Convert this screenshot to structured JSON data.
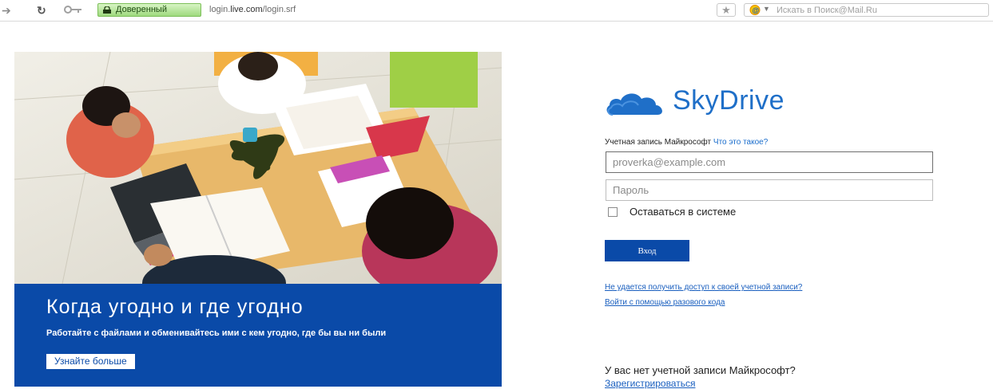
{
  "browser": {
    "forward_icon": "forward-arrow-icon",
    "reload_icon": "reload-icon",
    "key_icon": "key-icon",
    "trust_badge": "Доверенный",
    "url_prefix": "login.",
    "url_domain": "live.com",
    "url_path": "/login.srf",
    "search_placeholder": "Искать в Поиск@Mail.Ru"
  },
  "hero": {
    "title": "Когда угодно и где угодно",
    "subtitle": "Работайте с файлами и обменивайтесь ими с кем угодно, где бы вы ни были",
    "learn_more": "Узнайте больше",
    "accent_color": "#0a4aa8"
  },
  "login": {
    "brand": "SkyDrive",
    "account_label": "Учетная запись Майкрософт",
    "what_is_link": "Что это такое?",
    "email_value": "proverka@example.com",
    "password_placeholder": "Пароль",
    "remember_label": "Оставаться в системе",
    "signin_button": "Вход",
    "cant_access_link": "Не удается получить доступ к своей учетной записи?",
    "one_time_code_link": "Войти с помощью разового кода",
    "no_account_text": "У вас нет учетной записи Майкрософт?",
    "register_link": "Зарегистрироваться",
    "brand_color": "#1f6fc8",
    "link_color": "#1a5fbf"
  }
}
